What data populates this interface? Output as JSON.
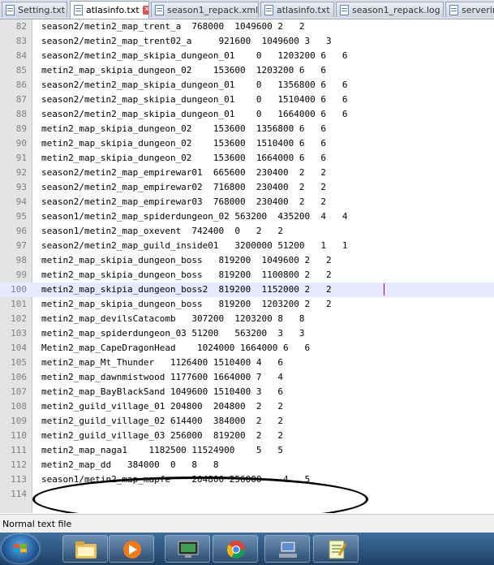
{
  "tabs": [
    {
      "label": "Setting.txt",
      "active": false,
      "closable": false
    },
    {
      "label": "atlasinfo.txt",
      "active": true,
      "closable": true
    },
    {
      "label": "season1_repack.xml",
      "active": false,
      "closable": false
    },
    {
      "label": "atlasinfo.txt",
      "active": false,
      "closable": false
    },
    {
      "label": "season1_repack.log",
      "active": false,
      "closable": false
    },
    {
      "label": "serverinfo",
      "active": false,
      "closable": false
    }
  ],
  "editor": {
    "current_line": "100",
    "lines": [
      {
        "num": "82",
        "text": "season2/metin2_map_trent_a  768000  1049600 2   2"
      },
      {
        "num": "83",
        "text": "season2/metin2_map_trent02_a     921600  1049600 3   3"
      },
      {
        "num": "84",
        "text": "season2/metin2_map_skipia_dungeon_01    0   1203200 6   6"
      },
      {
        "num": "85",
        "text": "metin2_map_skipia_dungeon_02    153600  1203200 6   6"
      },
      {
        "num": "86",
        "text": "season2/metin2_map_skipia_dungeon_01    0   1356800 6   6"
      },
      {
        "num": "87",
        "text": "season2/metin2_map_skipia_dungeon_01    0   1510400 6   6"
      },
      {
        "num": "88",
        "text": "season2/metin2_map_skipia_dungeon_01    0   1664000 6   6"
      },
      {
        "num": "89",
        "text": "metin2_map_skipia_dungeon_02    153600  1356800 6   6"
      },
      {
        "num": "90",
        "text": "metin2_map_skipia_dungeon_02    153600  1510400 6   6"
      },
      {
        "num": "91",
        "text": "metin2_map_skipia_dungeon_02    153600  1664000 6   6"
      },
      {
        "num": "92",
        "text": "season2/metin2_map_empirewar01  665600  230400  2   2"
      },
      {
        "num": "93",
        "text": "season2/metin2_map_empirewar02  716800  230400  2   2"
      },
      {
        "num": "94",
        "text": "season2/metin2_map_empirewar03  768000  230400  2   2"
      },
      {
        "num": "95",
        "text": "season1/metin2_map_spiderdungeon_02 563200  435200  4   4"
      },
      {
        "num": "96",
        "text": "season1/metin2_map_oxevent  742400  0   2   2"
      },
      {
        "num": "97",
        "text": "season2/metin2_map_guild_inside01   3200000 51200   1   1"
      },
      {
        "num": "98",
        "text": "metin2_map_skipia_dungeon_boss   819200  1049600 2   2"
      },
      {
        "num": "99",
        "text": "metin2_map_skipia_dungeon_boss   819200  1100800 2   2"
      },
      {
        "num": "100",
        "text": "metin2_map_skipia_dungeon_boss2  819200  1152000 2   2"
      },
      {
        "num": "101",
        "text": "metin2_map_skipia_dungeon_boss   819200  1203200 2   2"
      },
      {
        "num": "102",
        "text": "metin2_map_devilsCatacomb   307200  1203200 8   8"
      },
      {
        "num": "103",
        "text": "metin2_map_spiderdungeon_03 51200   563200  3   3"
      },
      {
        "num": "104",
        "text": "Metin2_map_CapeDragonHead    1024000 1664000 6   6"
      },
      {
        "num": "105",
        "text": "metin2_map_Mt_Thunder   1126400 1510400 4   6"
      },
      {
        "num": "106",
        "text": "metin2_map_dawnmistwood 1177600 1664000 7   4"
      },
      {
        "num": "107",
        "text": "metin2_map_BayBlackSand 1049600 1510400 3   6"
      },
      {
        "num": "108",
        "text": "metin2_guild_village_01 204800  204800  2   2"
      },
      {
        "num": "109",
        "text": "metin2_guild_village_02 614400  384000  2   2"
      },
      {
        "num": "110",
        "text": "metin2_guild_village_03 256000  819200  2   2"
      },
      {
        "num": "111",
        "text": "metin2_map_naga1    1182500 11524900    5   5"
      },
      {
        "num": "112",
        "text": "metin2_map_dd   384000  0   8   8"
      },
      {
        "num": "113",
        "text": "season1/metin2_map_mapfe    204800 256000    4   5"
      },
      {
        "num": "114",
        "text": ""
      }
    ]
  },
  "status": {
    "file_type": "Normal text file"
  },
  "taskbar": {
    "items": [
      {
        "icon": "folder-explorer-icon"
      },
      {
        "icon": "media-player-icon"
      },
      {
        "icon": "computer-monitor-icon"
      },
      {
        "icon": "chrome-browser-icon"
      },
      {
        "icon": "network-computer-icon"
      },
      {
        "icon": "notepad-plus-plus-icon"
      }
    ]
  },
  "colors": {
    "current_line_bg": "#e8e8ff",
    "gutter_bg": "#e4e4e4",
    "caret": "#8000ff",
    "taskbar": "#2b5580"
  }
}
